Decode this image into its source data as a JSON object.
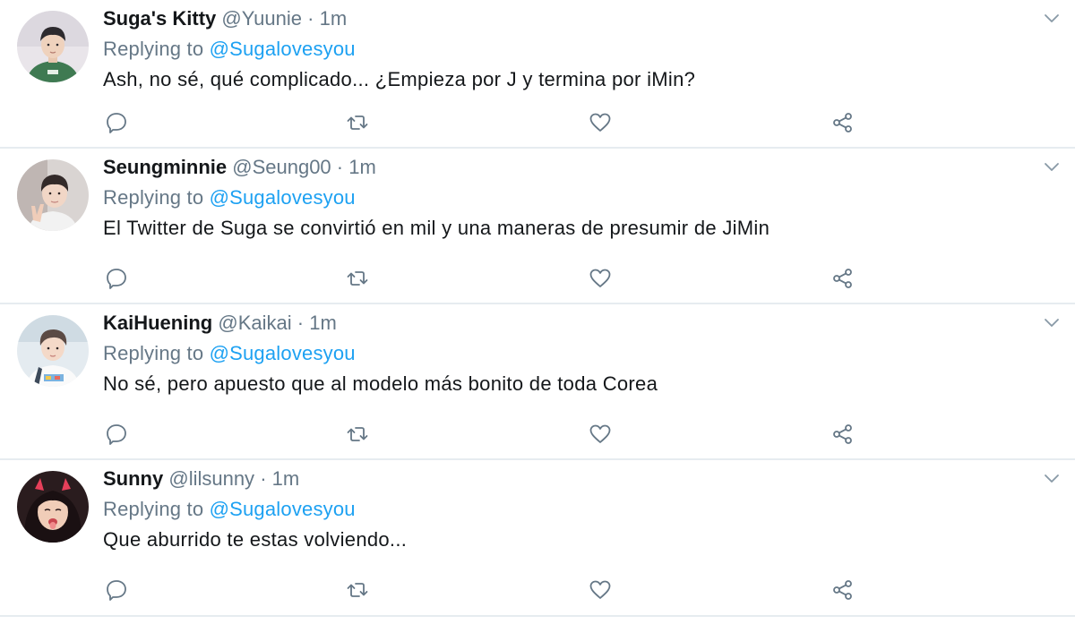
{
  "feed": {
    "reply_prefix": "Replying to ",
    "tweets": [
      {
        "name": "Suga's Kitty",
        "handle": "@Yuunie",
        "separator": "·",
        "time": "1m",
        "replying_to": "@Sugalovesyou",
        "text": "Ash, no sé, qué  complicado... ¿Empieza por J y termina por iMin?",
        "avatar": "avatar-green-shirt"
      },
      {
        "name": "Seungminnie",
        "handle": "@Seung00",
        "separator": "·",
        "time": "1m",
        "replying_to": "@Sugalovesyou",
        "text": "El Twitter de Suga se convirtió en mil y una maneras de presumir de JiMin",
        "avatar": "avatar-peace-sign"
      },
      {
        "name": "KaiHuening",
        "handle": "@Kaikai",
        "separator": "·",
        "time": "1m",
        "replying_to": "@Sugalovesyou",
        "text": "No sé, pero apuesto que al modelo más bonito de toda Corea",
        "avatar": "avatar-white-shirt"
      },
      {
        "name": "Sunny",
        "handle": "@lilsunny",
        "separator": "·",
        "time": "1m",
        "replying_to": "@Sugalovesyou",
        "text": "Que aburrido te estas volviendo...",
        "avatar": "avatar-devil-horns"
      }
    ]
  },
  "colors": {
    "text": "#14171a",
    "muted": "#657786",
    "link": "#1da1f2",
    "divider": "#e6ecf0"
  },
  "icons": [
    "reply-icon",
    "retweet-icon",
    "like-icon",
    "share-icon",
    "chevron-down-icon"
  ]
}
